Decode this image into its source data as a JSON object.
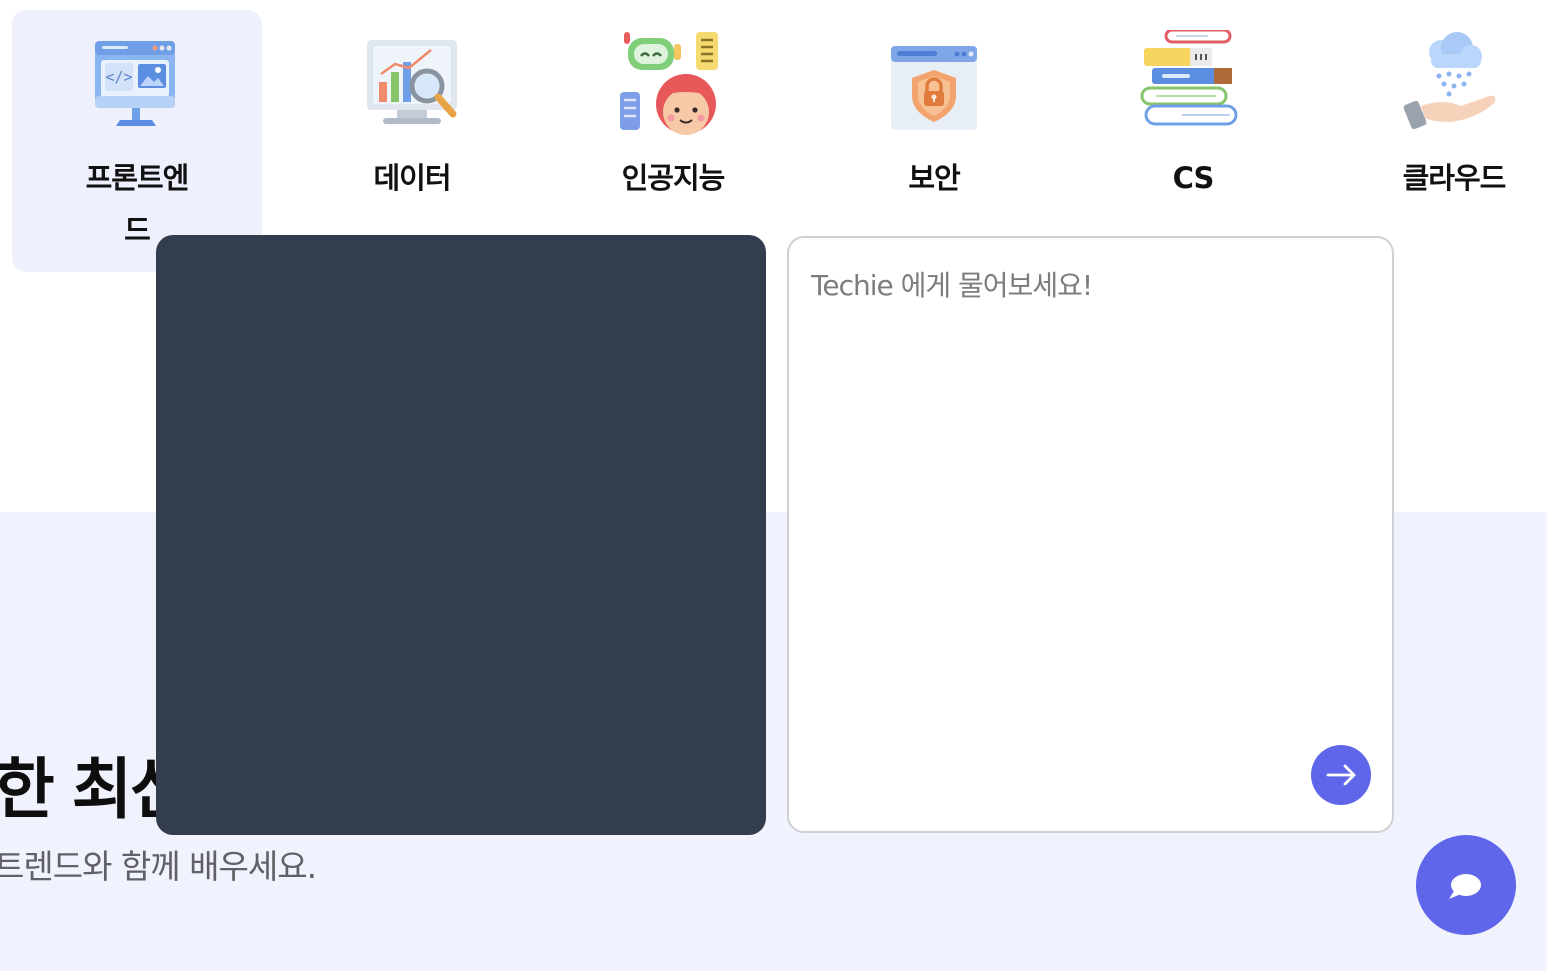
{
  "categories": [
    {
      "label": "프론트엔드",
      "icon": "frontend-monitor-icon",
      "active": true
    },
    {
      "label": "데이터",
      "icon": "data-chart-icon",
      "active": false
    },
    {
      "label": "인공지능",
      "icon": "ai-robot-icon",
      "active": false
    },
    {
      "label": "보안",
      "icon": "security-lock-icon",
      "active": false
    },
    {
      "label": "CS",
      "icon": "cs-books-icon",
      "active": false
    },
    {
      "label": "클라우드",
      "icon": "cloud-hand-icon",
      "active": false
    }
  ],
  "hero": {
    "headline": "한 최신",
    "subline": "트렌드와 함께 배우세요."
  },
  "chat": {
    "placeholder": "Techie 에게 물어보세요!",
    "send_icon": "arrow-right-icon",
    "fab_icon": "chat-bubble-icon"
  },
  "colors": {
    "accent": "#5f66ea",
    "panel_dark": "#333d4d",
    "band_bg": "#f0f2fd",
    "active_tile": "#eef1fd"
  }
}
